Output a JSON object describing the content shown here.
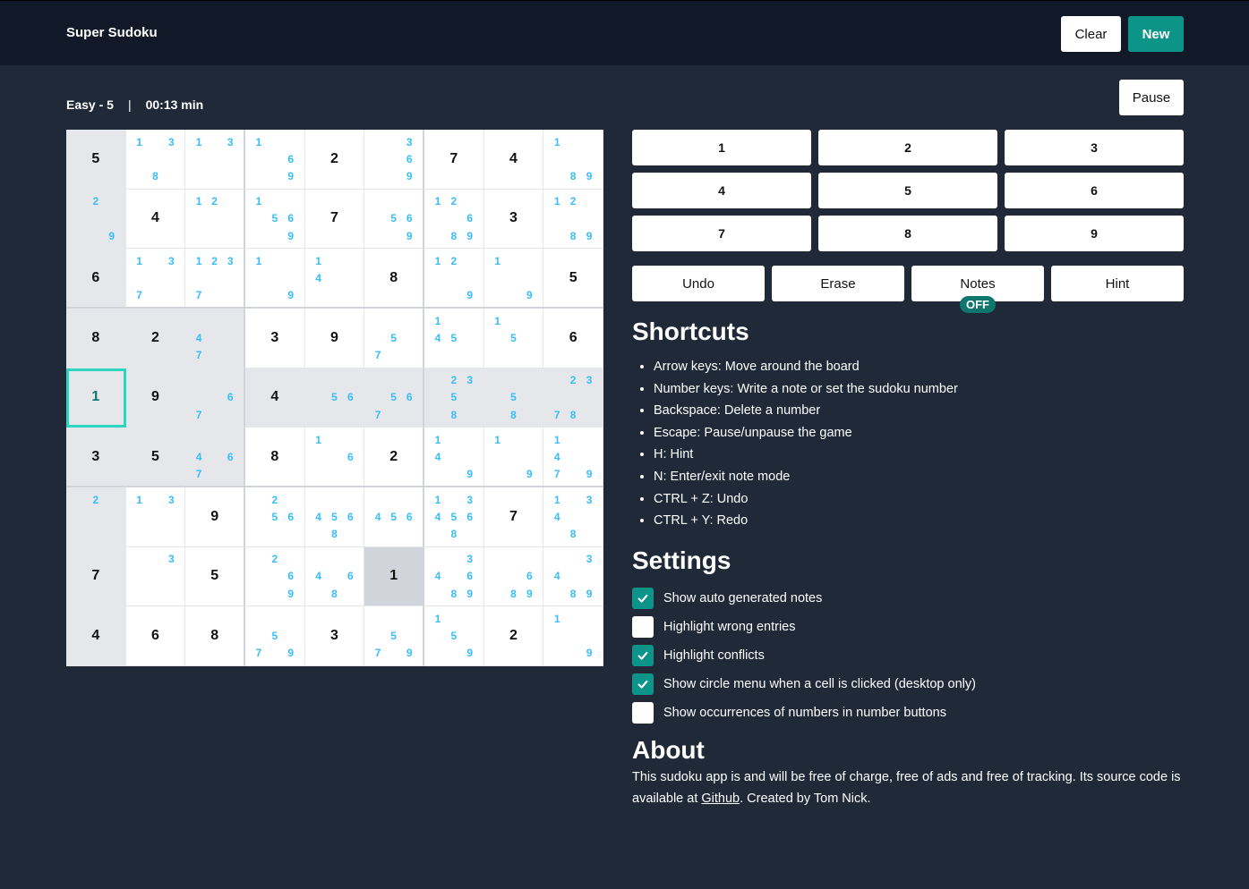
{
  "header": {
    "title": "Super Sudoku",
    "clear_label": "Clear",
    "new_label": "New"
  },
  "status": {
    "difficulty": "Easy - 5",
    "separator": "|",
    "timer": "00:13 min",
    "pause_label": "Pause"
  },
  "board": {
    "selected": [
      4,
      0
    ],
    "cells": [
      [
        {
          "v": "5",
          "hl": true
        },
        {
          "n": [
            1,
            3,
            8
          ]
        },
        {
          "n": [
            1,
            3
          ]
        },
        {
          "n": [
            1,
            6,
            9
          ]
        },
        {
          "v": "2"
        },
        {
          "n": [
            3,
            6,
            9
          ]
        },
        {
          "v": "7"
        },
        {
          "v": "4"
        },
        {
          "n": [
            1,
            8,
            9
          ]
        }
      ],
      [
        {
          "n": [
            2,
            9
          ],
          "hl": true
        },
        {
          "v": "4"
        },
        {
          "n": [
            1,
            2
          ]
        },
        {
          "n": [
            1,
            5,
            6,
            9
          ]
        },
        {
          "v": "7"
        },
        {
          "n": [
            5,
            6,
            9
          ]
        },
        {
          "n": [
            1,
            2,
            6,
            8,
            9
          ]
        },
        {
          "v": "3"
        },
        {
          "n": [
            1,
            2,
            8,
            9
          ]
        }
      ],
      [
        {
          "v": "6",
          "hl": true
        },
        {
          "n": [
            1,
            3,
            7
          ]
        },
        {
          "n": [
            1,
            2,
            3,
            7
          ]
        },
        {
          "n": [
            1,
            9
          ]
        },
        {
          "n": [
            1,
            4
          ]
        },
        {
          "v": "8"
        },
        {
          "n": [
            1,
            2,
            9
          ]
        },
        {
          "n": [
            1,
            9
          ]
        },
        {
          "v": "5"
        }
      ],
      [
        {
          "v": "8",
          "hl": true
        },
        {
          "v": "2",
          "hl": true
        },
        {
          "n": [
            4,
            7
          ],
          "hl": true
        },
        {
          "v": "3"
        },
        {
          "v": "9"
        },
        {
          "n": [
            5,
            7
          ]
        },
        {
          "n": [
            1,
            4,
            5
          ]
        },
        {
          "n": [
            1,
            5
          ]
        },
        {
          "v": "6"
        }
      ],
      [
        {
          "v": "1",
          "hl": true,
          "sel": true
        },
        {
          "v": "9",
          "hl": true
        },
        {
          "n": [
            6,
            7
          ],
          "hl": true
        },
        {
          "v": "4",
          "hl": true
        },
        {
          "n": [
            5,
            6
          ],
          "hl": true
        },
        {
          "n": [
            5,
            6,
            7
          ],
          "hl": true
        },
        {
          "n": [
            2,
            3,
            5,
            8
          ],
          "hl": true
        },
        {
          "n": [
            5,
            8
          ],
          "hl": true
        },
        {
          "n": [
            2,
            3,
            7,
            8
          ],
          "hl": true
        }
      ],
      [
        {
          "v": "3",
          "hl": true
        },
        {
          "v": "5",
          "hl": true
        },
        {
          "n": [
            4,
            6,
            7
          ],
          "hl": true
        },
        {
          "v": "8"
        },
        {
          "n": [
            1,
            6
          ]
        },
        {
          "v": "2"
        },
        {
          "n": [
            1,
            4,
            9
          ]
        },
        {
          "n": [
            1,
            9
          ]
        },
        {
          "n": [
            1,
            4,
            7,
            9
          ]
        }
      ],
      [
        {
          "n": [
            2
          ],
          "hl": true
        },
        {
          "n": [
            1,
            3
          ]
        },
        {
          "v": "9"
        },
        {
          "n": [
            2,
            5,
            6
          ]
        },
        {
          "n": [
            4,
            5,
            6,
            8
          ]
        },
        {
          "n": [
            4,
            5,
            6
          ]
        },
        {
          "n": [
            1,
            3,
            4,
            5,
            6,
            8
          ]
        },
        {
          "v": "7"
        },
        {
          "n": [
            1,
            3,
            4,
            8
          ]
        }
      ],
      [
        {
          "v": "7",
          "hl": true
        },
        {
          "n": [
            3
          ]
        },
        {
          "v": "5"
        },
        {
          "n": [
            2,
            6,
            9
          ]
        },
        {
          "n": [
            4,
            6,
            8
          ]
        },
        {
          "v": "1",
          "same": true
        },
        {
          "n": [
            3,
            4,
            6,
            8,
            9
          ]
        },
        {
          "n": [
            6,
            8,
            9
          ]
        },
        {
          "n": [
            3,
            4,
            8,
            9
          ]
        }
      ],
      [
        {
          "v": "4",
          "hl": true
        },
        {
          "v": "6"
        },
        {
          "v": "8"
        },
        {
          "n": [
            5,
            7,
            9
          ]
        },
        {
          "v": "3"
        },
        {
          "n": [
            5,
            7,
            9
          ]
        },
        {
          "n": [
            1,
            5,
            9
          ]
        },
        {
          "v": "2"
        },
        {
          "n": [
            1,
            9
          ]
        }
      ]
    ]
  },
  "numpad": [
    "1",
    "2",
    "3",
    "4",
    "5",
    "6",
    "7",
    "8",
    "9"
  ],
  "actions": {
    "undo": "Undo",
    "erase": "Erase",
    "notes": "Notes",
    "notes_state": "OFF",
    "hint": "Hint"
  },
  "shortcuts": {
    "title": "Shortcuts",
    "items": [
      "Arrow keys: Move around the board",
      "Number keys: Write a note or set the sudoku number",
      "Backspace: Delete a number",
      "Escape: Pause/unpause the game",
      "H: Hint",
      "N: Enter/exit note mode",
      "CTRL + Z: Undo",
      "CTRL + Y: Redo"
    ]
  },
  "settings": {
    "title": "Settings",
    "items": [
      {
        "label": "Show auto generated notes",
        "checked": true
      },
      {
        "label": "Highlight wrong entries",
        "checked": false
      },
      {
        "label": "Highlight conflicts",
        "checked": true
      },
      {
        "label": "Show circle menu when a cell is clicked (desktop only)",
        "checked": true
      },
      {
        "label": "Show occurrences of numbers in number buttons",
        "checked": false
      }
    ]
  },
  "about": {
    "title": "About",
    "text_before": "This sudoku app is and will be free of charge, free of ads and free of tracking. Its source code is available at ",
    "link_label": "Github",
    "text_after": ". Created by Tom Nick."
  },
  "colors": {
    "accent": "#0d9488",
    "note": "#38bdf8",
    "selected_border": "#2dd4bf",
    "background": "#1f2937",
    "topbar": "#111827"
  }
}
